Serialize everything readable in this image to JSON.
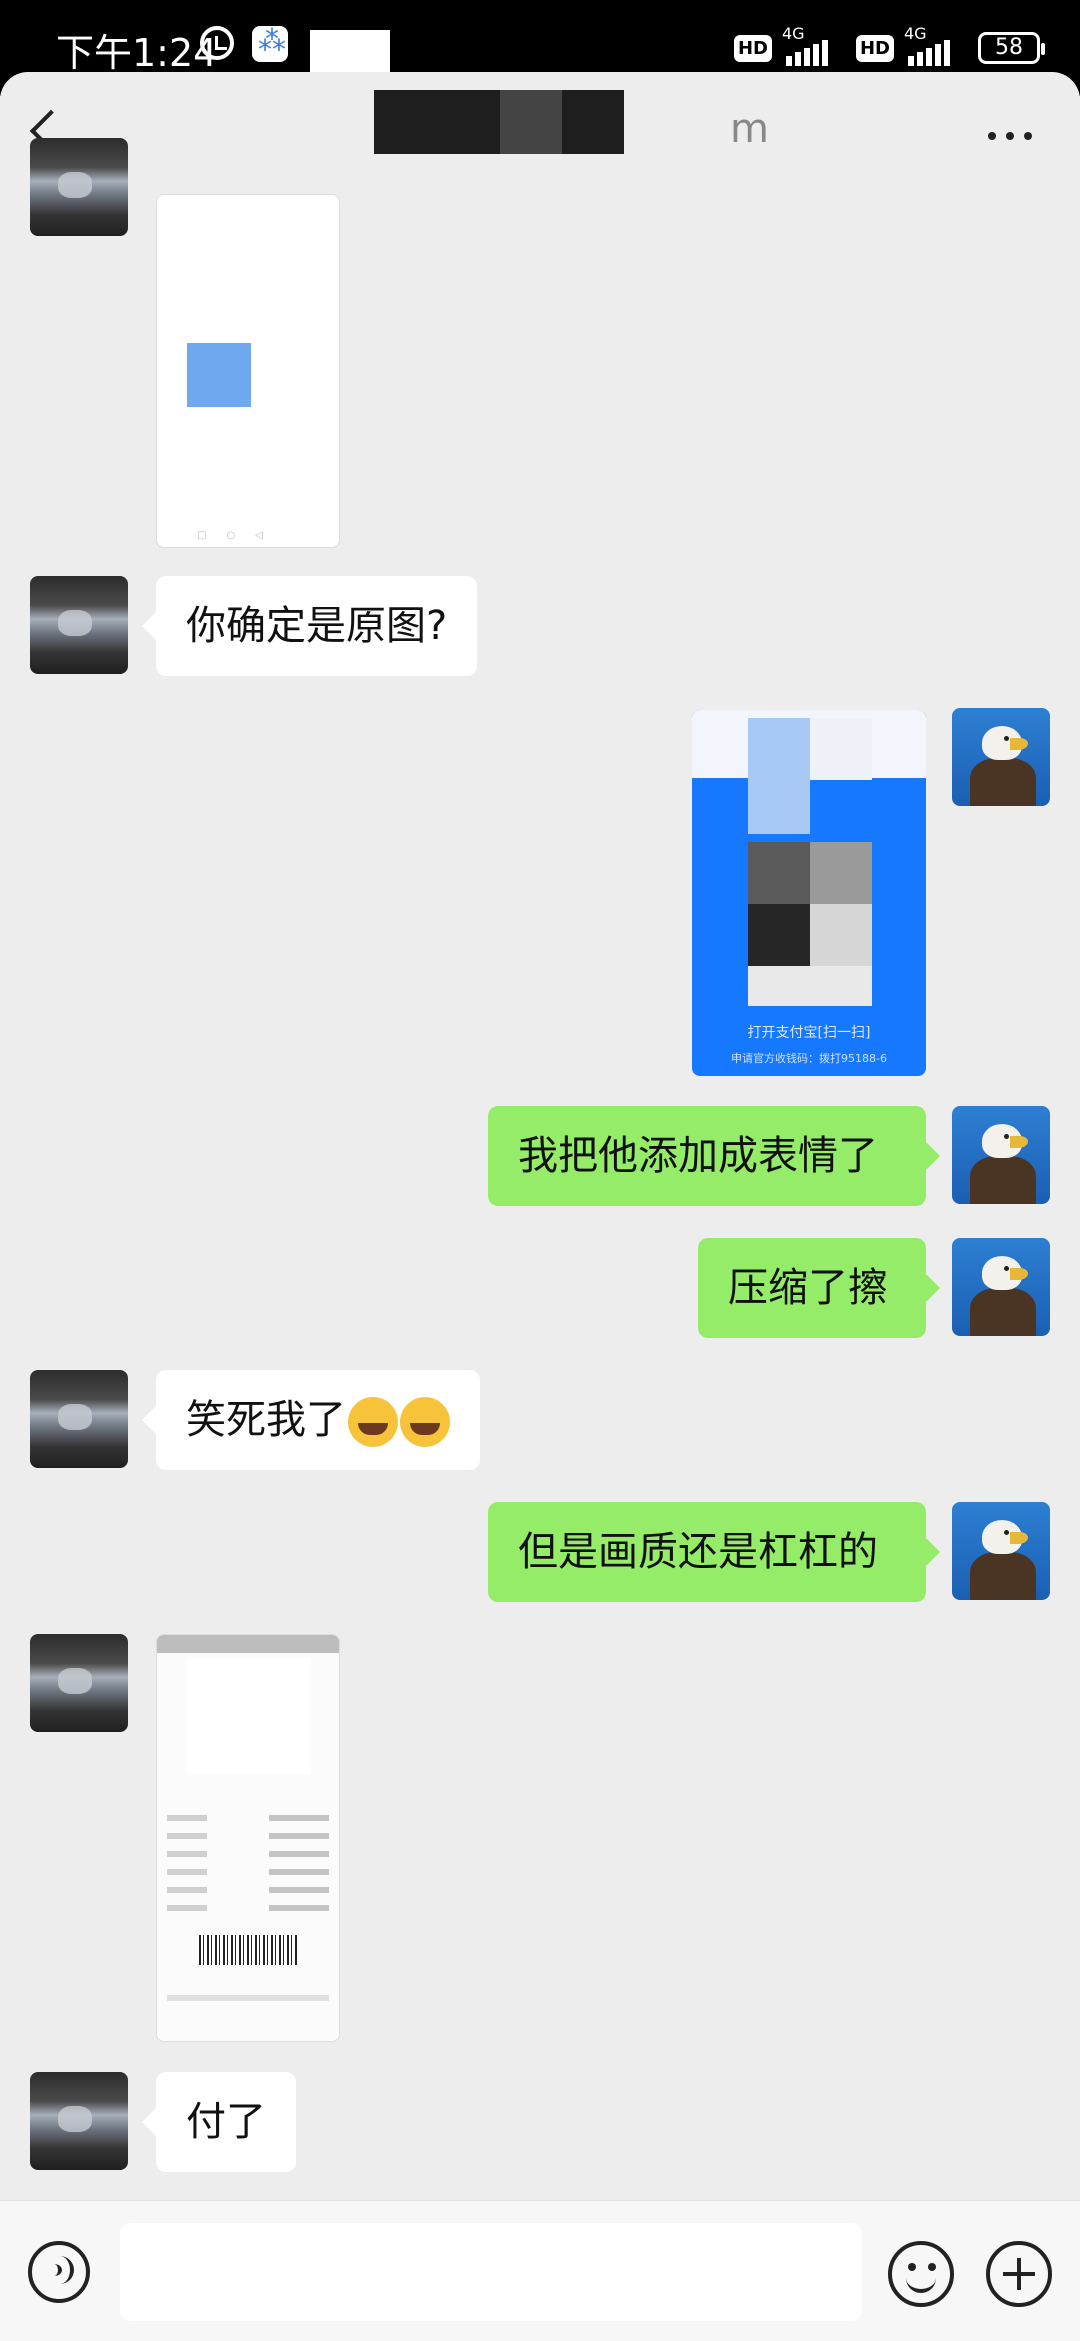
{
  "status_bar": {
    "time": "下午1:24",
    "battery": "58",
    "network_label": "4G",
    "hd_label": "HD"
  },
  "header": {
    "title_tail": "m"
  },
  "messages": [
    {
      "from": "them",
      "type": "image"
    },
    {
      "from": "them",
      "type": "text",
      "text": "你确定是原图?"
    },
    {
      "from": "me",
      "type": "image",
      "caption1": "打开支付宝[扫一扫]",
      "caption2": "申请官方收钱码：拨打95188-6"
    },
    {
      "from": "me",
      "type": "text",
      "text": "我把他添加成表情了"
    },
    {
      "from": "me",
      "type": "text",
      "text": "压缩了擦"
    },
    {
      "from": "them",
      "type": "text",
      "text": "笑死我了"
    },
    {
      "from": "me",
      "type": "text",
      "text": "但是画质还是杠杠的"
    },
    {
      "from": "them",
      "type": "image"
    },
    {
      "from": "them",
      "type": "text",
      "text": "付了"
    }
  ],
  "input_bar": {
    "icons": [
      "voice-icon",
      "emoji-icon",
      "plus-icon"
    ]
  },
  "colors": {
    "me_bubble": "#95ec69",
    "them_bubble": "#ffffff",
    "background": "#ededed"
  }
}
